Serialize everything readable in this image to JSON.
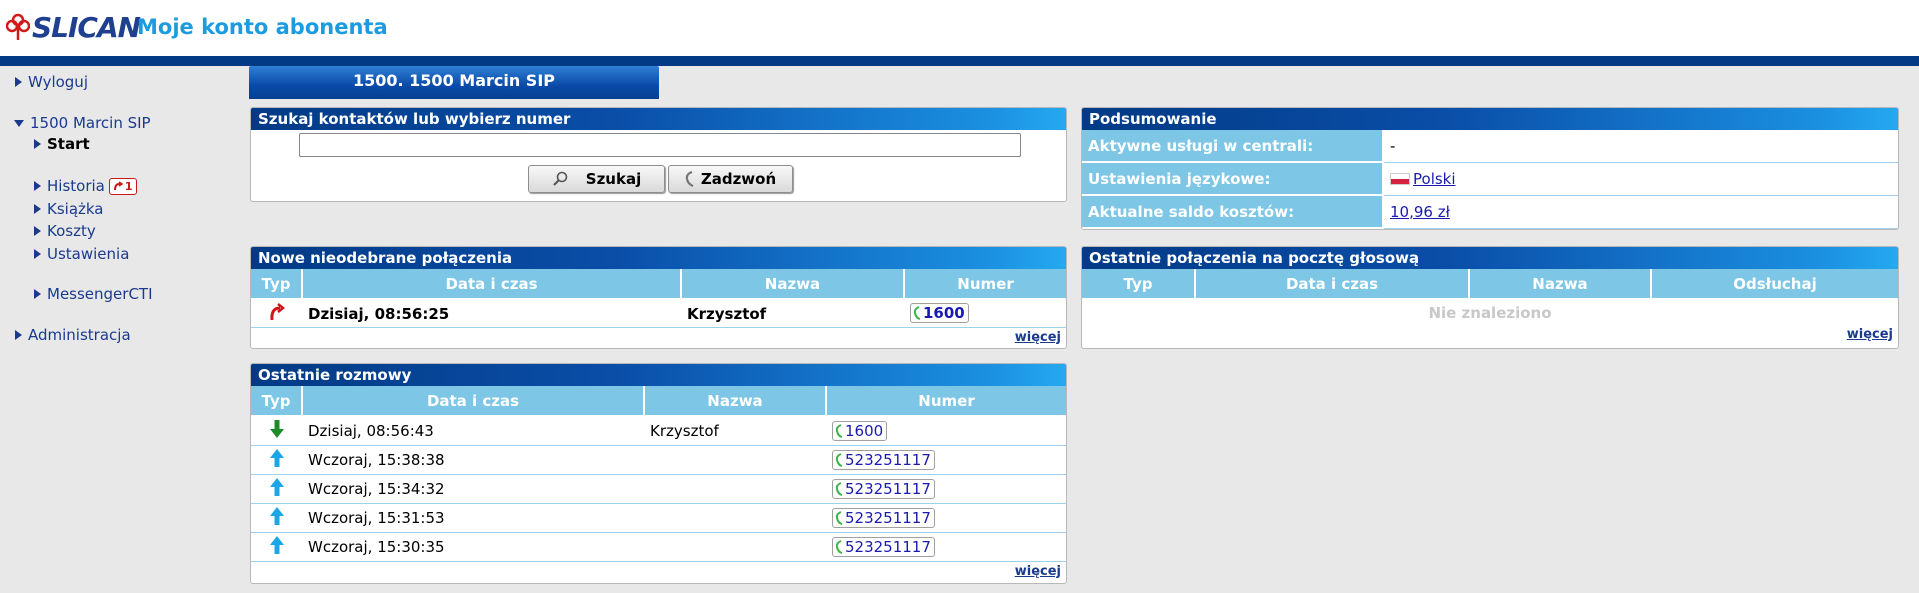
{
  "brand": {
    "logo_text": "SLICAN",
    "app_title": "Moje konto abonenta"
  },
  "nav": {
    "logout": "Wyloguj",
    "account": "1500 Marcin SIP",
    "start": "Start",
    "history": "Historia",
    "history_badge": "1",
    "book": "Książka",
    "costs": "Koszty",
    "settings": "Ustawienia",
    "messenger": "MessengerCTI",
    "admin": "Administracja"
  },
  "tab": {
    "label": "1500. 1500 Marcin SIP"
  },
  "search": {
    "title": "Szukaj kontaktów lub wybierz numer",
    "value": "",
    "search_button": "Szukaj",
    "call_button": "Zadzwoń"
  },
  "summary": {
    "title": "Podsumowanie",
    "rows": [
      {
        "label": "Aktywne usługi w centrali:",
        "value": "-"
      },
      {
        "label": "Ustawienia językowe:",
        "value": "Polski"
      },
      {
        "label": "Aktualne saldo kosztów:",
        "value": "10,96 zł"
      }
    ]
  },
  "missed": {
    "title": "Nowe nieodebrane połączenia",
    "headers": [
      "Typ",
      "Data i czas",
      "Nazwa",
      "Numer"
    ],
    "rows": [
      {
        "type": "missed",
        "datetime": "Dzisiaj, 08:56:25",
        "name": "Krzysztof",
        "number": "1600"
      }
    ],
    "more": "więcej"
  },
  "voicemail": {
    "title": "Ostatnie połączenia na pocztę głosową",
    "headers": [
      "Typ",
      "Data i czas",
      "Nazwa",
      "Odsłuchaj"
    ],
    "empty": "Nie znaleziono",
    "more": "więcej"
  },
  "recent": {
    "title": "Ostatnie rozmowy",
    "headers": [
      "Typ",
      "Data i czas",
      "Nazwa",
      "Numer"
    ],
    "rows": [
      {
        "type": "incoming",
        "datetime": "Dzisiaj, 08:56:43",
        "name": "Krzysztof",
        "number": "1600"
      },
      {
        "type": "outgoing",
        "datetime": "Wczoraj, 15:38:38",
        "name": "",
        "number": "523251117"
      },
      {
        "type": "outgoing",
        "datetime": "Wczoraj, 15:34:32",
        "name": "",
        "number": "523251117"
      },
      {
        "type": "outgoing",
        "datetime": "Wczoraj, 15:31:53",
        "name": "",
        "number": "523251117"
      },
      {
        "type": "outgoing",
        "datetime": "Wczoraj, 15:30:35",
        "name": "",
        "number": "523251117"
      }
    ],
    "more": "więcej"
  },
  "colors": {
    "brand_blue": "#1b9be0",
    "bar_dark": "#023a85",
    "header_cell": "#7dc6e6"
  }
}
